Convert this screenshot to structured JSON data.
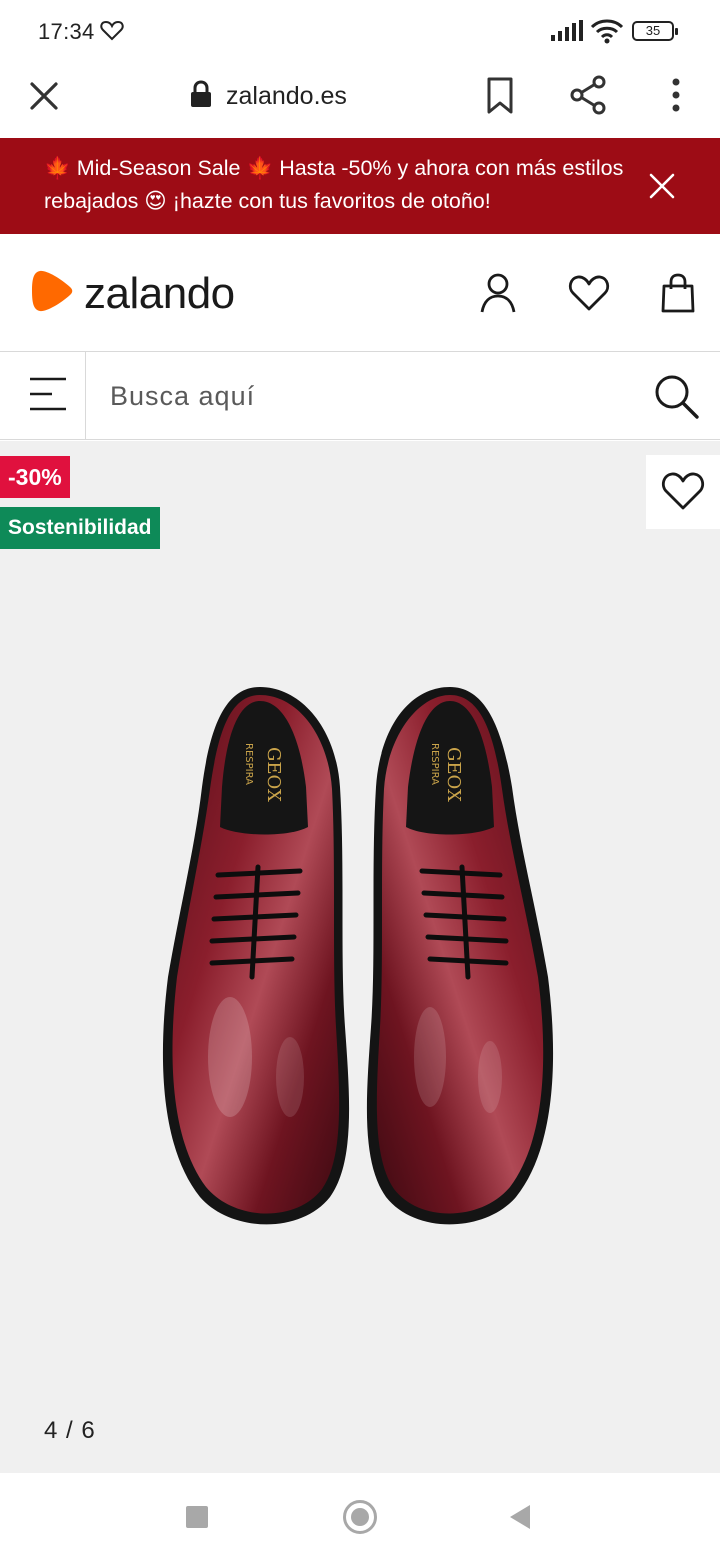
{
  "status_bar": {
    "time": "17:34",
    "battery": "35",
    "icons": [
      "heart-outline-icon",
      "signal-icon",
      "wifi-icon",
      "battery-icon"
    ]
  },
  "browser": {
    "url": "zalando.es",
    "icons": [
      "close-icon",
      "lock-icon",
      "bookmark-icon",
      "share-icon",
      "more-vert-icon"
    ]
  },
  "promo": {
    "text": "🍁 Mid-Season Sale 🍁 Hasta -50% y ahora con más estilos rebajados 😍 ¡hazte con tus favoritos de otoño!",
    "background": "#9d0c15"
  },
  "header": {
    "logo_text": "zalando",
    "brand_color": "#ff6900",
    "icons": [
      "user-icon",
      "heart-icon",
      "bag-icon"
    ]
  },
  "search": {
    "placeholder": "Busca aquí"
  },
  "product": {
    "discount_badge": "-30%",
    "discount_color": "#e0113e",
    "sustainability_badge": "Sostenibilidad",
    "sustainability_color": "#0e8a58",
    "brand_insole": "GEOX",
    "insole_sub": "RESPIRA",
    "pager": "4 / 6"
  },
  "nav_bar": {
    "icons": [
      "recents-icon",
      "home-icon",
      "back-icon"
    ]
  }
}
